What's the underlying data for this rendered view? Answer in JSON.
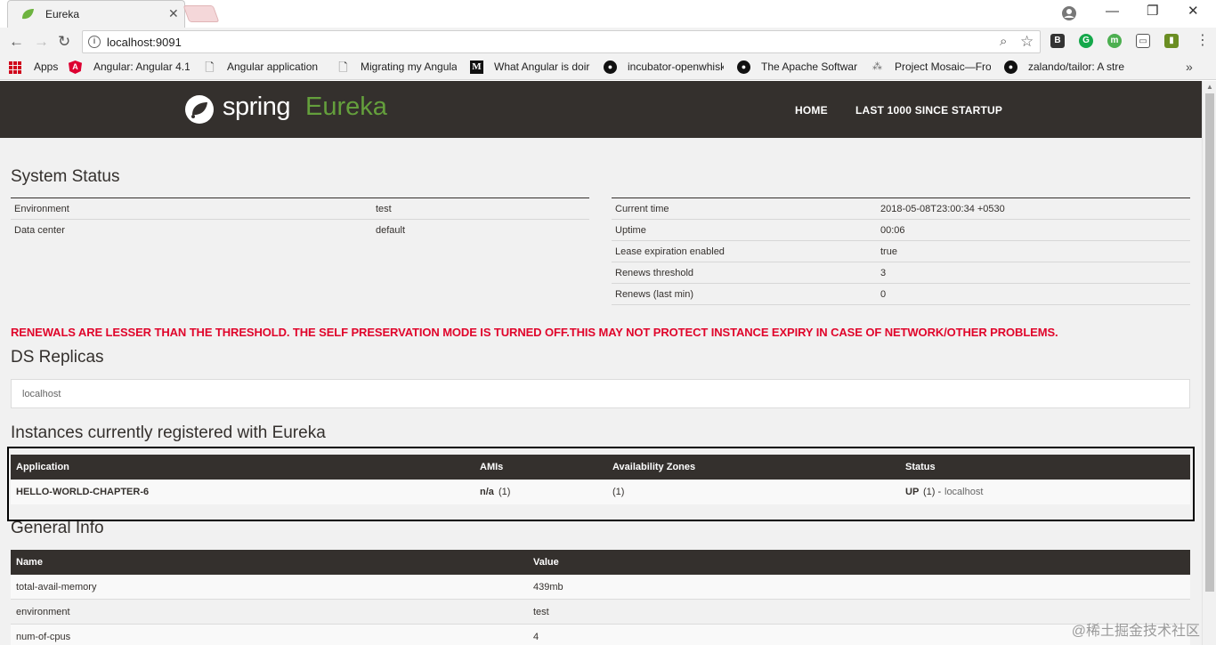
{
  "browser": {
    "tab_title": "Eureka",
    "url": "localhost:9091",
    "bookmarks": [
      {
        "label": "Apps",
        "icon": "apps-grid-icon"
      },
      {
        "label": "Angular: Angular 4.1",
        "icon": "angular-icon"
      },
      {
        "label": "Angular application",
        "icon": "page-icon"
      },
      {
        "label": "Migrating my Angula",
        "icon": "page-icon"
      },
      {
        "label": "What Angular is doir",
        "icon": "medium-icon"
      },
      {
        "label": "incubator-openwhisk",
        "icon": "github-icon"
      },
      {
        "label": "The Apache Softwar",
        "icon": "github-icon"
      },
      {
        "label": "Project Mosaic—Fro",
        "icon": "mosaic-icon"
      },
      {
        "label": "zalando/tailor: A stre",
        "icon": "github-icon"
      }
    ]
  },
  "header": {
    "brand_spring": "spring",
    "brand_eureka": "Eureka",
    "nav": [
      "HOME",
      "LAST 1000 SINCE STARTUP"
    ]
  },
  "system_status": {
    "title": "System Status",
    "left": [
      {
        "key": "Environment",
        "value": "test"
      },
      {
        "key": "Data center",
        "value": "default"
      }
    ],
    "right": [
      {
        "key": "Current time",
        "value": "2018-05-08T23:00:34 +0530"
      },
      {
        "key": "Uptime",
        "value": "00:06"
      },
      {
        "key": "Lease expiration enabled",
        "value": "true"
      },
      {
        "key": "Renews threshold",
        "value": "3"
      },
      {
        "key": "Renews (last min)",
        "value": "0"
      }
    ]
  },
  "warning": "RENEWALS ARE LESSER THAN THE THRESHOLD. THE SELF PRESERVATION MODE IS TURNED OFF.THIS MAY NOT PROTECT INSTANCE EXPIRY IN CASE OF NETWORK/OTHER PROBLEMS.",
  "ds_replicas": {
    "title": "DS Replicas",
    "items": [
      "localhost"
    ]
  },
  "instances": {
    "title": "Instances currently registered with Eureka",
    "headers": [
      "Application",
      "AMIs",
      "Availability Zones",
      "Status"
    ],
    "rows": [
      {
        "application": "HELLO-WORLD-CHAPTER-6",
        "amis": "n/a",
        "amis_count": "(1)",
        "zones": "(1)",
        "status": "UP",
        "status_count": "(1) -",
        "status_link": "localhost"
      }
    ]
  },
  "general_info": {
    "title": "General Info",
    "headers": [
      "Name",
      "Value"
    ],
    "rows": [
      {
        "name": "total-avail-memory",
        "value": "439mb"
      },
      {
        "name": "environment",
        "value": "test"
      },
      {
        "name": "num-of-cpus",
        "value": "4"
      }
    ]
  },
  "watermark": "@稀土掘金技术社区",
  "colors": {
    "navbar": "#34302d",
    "spring_green": "#6db33f",
    "warning_red": "#e0052b",
    "page_bg": "#f1f1f1"
  }
}
